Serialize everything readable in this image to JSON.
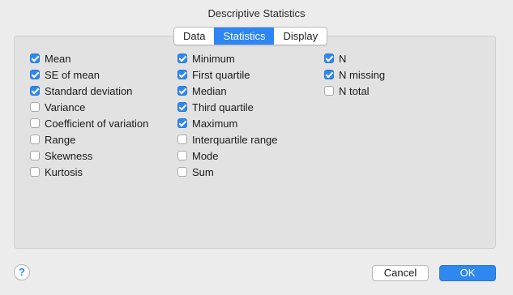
{
  "dialog": {
    "title": "Descriptive Statistics"
  },
  "tabs": [
    {
      "label": "Data",
      "active": false
    },
    {
      "label": "Statistics",
      "active": true
    },
    {
      "label": "Display",
      "active": false
    }
  ],
  "columns": [
    [
      {
        "label": "Mean",
        "checked": true
      },
      {
        "label": "SE of mean",
        "checked": true
      },
      {
        "label": "Standard deviation",
        "checked": true
      },
      {
        "label": "Variance",
        "checked": false
      },
      {
        "label": "Coefficient of variation",
        "checked": false
      },
      {
        "label": "Range",
        "checked": false
      },
      {
        "label": "Skewness",
        "checked": false
      },
      {
        "label": "Kurtosis",
        "checked": false
      }
    ],
    [
      {
        "label": "Minimum",
        "checked": true
      },
      {
        "label": "First quartile",
        "checked": true
      },
      {
        "label": "Median",
        "checked": true
      },
      {
        "label": "Third quartile",
        "checked": true
      },
      {
        "label": "Maximum",
        "checked": true
      },
      {
        "label": "Interquartile range",
        "checked": false
      },
      {
        "label": "Mode",
        "checked": false
      },
      {
        "label": "Sum",
        "checked": false
      }
    ],
    [
      {
        "label": "N",
        "checked": true
      },
      {
        "label": "N missing",
        "checked": true
      },
      {
        "label": "N total",
        "checked": false
      }
    ]
  ],
  "footer": {
    "help_label": "?",
    "cancel_label": "Cancel",
    "ok_label": "OK"
  },
  "colors": {
    "accent": "#2d86f4",
    "background": "#ececec",
    "panel": "#e2e2e2"
  }
}
